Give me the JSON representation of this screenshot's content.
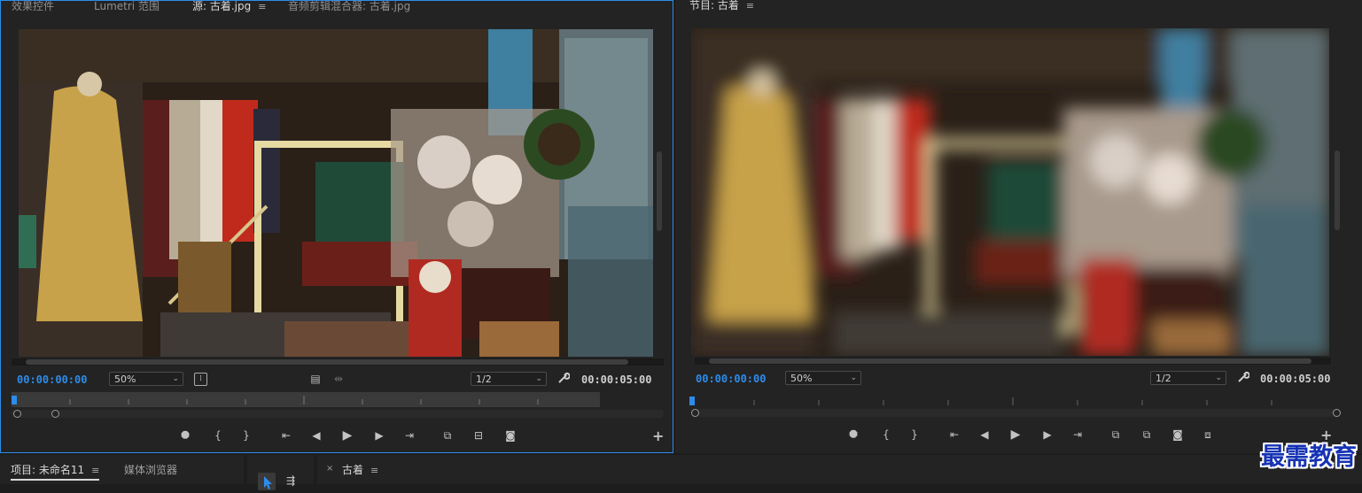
{
  "source_panel": {
    "tabs": [
      {
        "label": "效果控件",
        "active": false
      },
      {
        "label": "Lumetri 范围",
        "active": false
      },
      {
        "label": "源: 古着.jpg",
        "active": true
      },
      {
        "label": "音频剪辑混合器: 古着.jpg",
        "active": false
      }
    ],
    "timecode_current": "00:00:00:00",
    "zoom": "50%",
    "resolution": "1/2",
    "timecode_duration": "00:00:05:00"
  },
  "program_panel": {
    "tab_label": "节目: 古着",
    "timecode_current": "00:00:00:00",
    "zoom": "50%",
    "resolution": "1/2",
    "timecode_duration": "00:00:05:00"
  },
  "project_panel": {
    "tabs": [
      {
        "label": "项目: 未命名11",
        "active": true
      },
      {
        "label": "媒体浏览器",
        "active": false
      }
    ]
  },
  "timeline_panel": {
    "close_glyph": "×",
    "sequence_label": "古着"
  },
  "icons": {
    "menu": "≡",
    "dropdown": "⌄",
    "marker": "⯃",
    "mark_in": "{",
    "mark_out": "}",
    "goto_in": "⇤",
    "step_back": "◀",
    "play": "▶",
    "step_forward": "▶",
    "goto_out": "⇥",
    "insert": "⧉",
    "overwrite": "⊟",
    "export_frame": "◙",
    "compare": "⧈",
    "add": "+",
    "settings": "🔧"
  },
  "watermark": "最需教育",
  "colors": {
    "accent": "#2d8ceb",
    "panel_bg": "#232323",
    "app_bg": "#1d1d1d",
    "watermark": "#1633b4"
  }
}
